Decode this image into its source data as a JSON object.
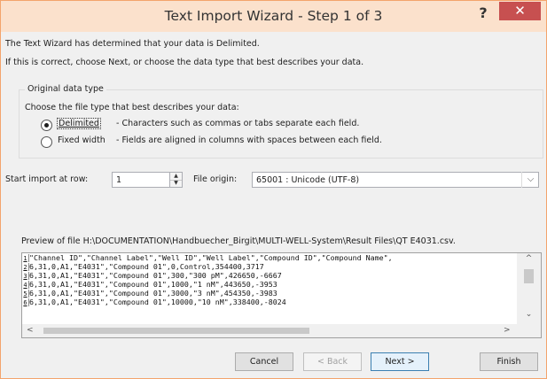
{
  "window": {
    "title": "Text Import Wizard - Step 1 of 3",
    "help_label": "?",
    "close_label": "✕"
  },
  "intro": {
    "line1": "The Text Wizard has determined that your data is Delimited.",
    "line2": "If this is correct, choose Next, or choose the data type that best describes your data."
  },
  "original_data_type": {
    "group_label": "Original data type",
    "prompt": "Choose the file type that best describes your data:",
    "options": [
      {
        "label": "Delimited",
        "description": "- Characters such as commas or tabs separate each field.",
        "selected": true
      },
      {
        "label": "Fixed width",
        "description": "- Fields are aligned in columns with spaces between each field.",
        "selected": false
      }
    ]
  },
  "start_row": {
    "label": "Start import at row:",
    "value": "1",
    "up_arrow": "▲",
    "down_arrow": "▼"
  },
  "file_origin": {
    "label": "File origin:",
    "value": "65001 : Unicode (UTF-8)",
    "dropdown_arrow": "⌵"
  },
  "preview": {
    "caption": "Preview of file H:\\DOCUMENTATION\\Handbuecher_Birgit\\MULTI-WELL-System\\Result Files\\QT E4031.csv.",
    "lines": [
      {
        "num": "1",
        "text": "\"Channel ID\",\"Channel Label\",\"Well ID\",\"Well Label\",\"Compound ID\",\"Compound Name\","
      },
      {
        "num": "2",
        "text": "6,31,0,A1,\"E4031\",\"Compound 01\",0,Control,354400,3717"
      },
      {
        "num": "3",
        "text": "6,31,0,A1,\"E4031\",\"Compound 01\",300,\"300 pM\",426650,-6667"
      },
      {
        "num": "4",
        "text": "6,31,0,A1,\"E4031\",\"Compound 01\",1000,\"1 nM\",443650,-3953"
      },
      {
        "num": "5",
        "text": "6,31,0,A1,\"E4031\",\"Compound 01\",3000,\"3 nM\",454350,-3983"
      },
      {
        "num": "6",
        "text": "6,31,0,A1,\"E4031\",\"Compound 01\",10000,\"10 nM\",338400,-8024"
      }
    ],
    "scroll_up": "^",
    "scroll_down": "⌄",
    "scroll_left": "<",
    "scroll_right": ">"
  },
  "buttons": {
    "cancel": "Cancel",
    "back": "< Back",
    "next": "Next >",
    "finish": "Finish"
  }
}
